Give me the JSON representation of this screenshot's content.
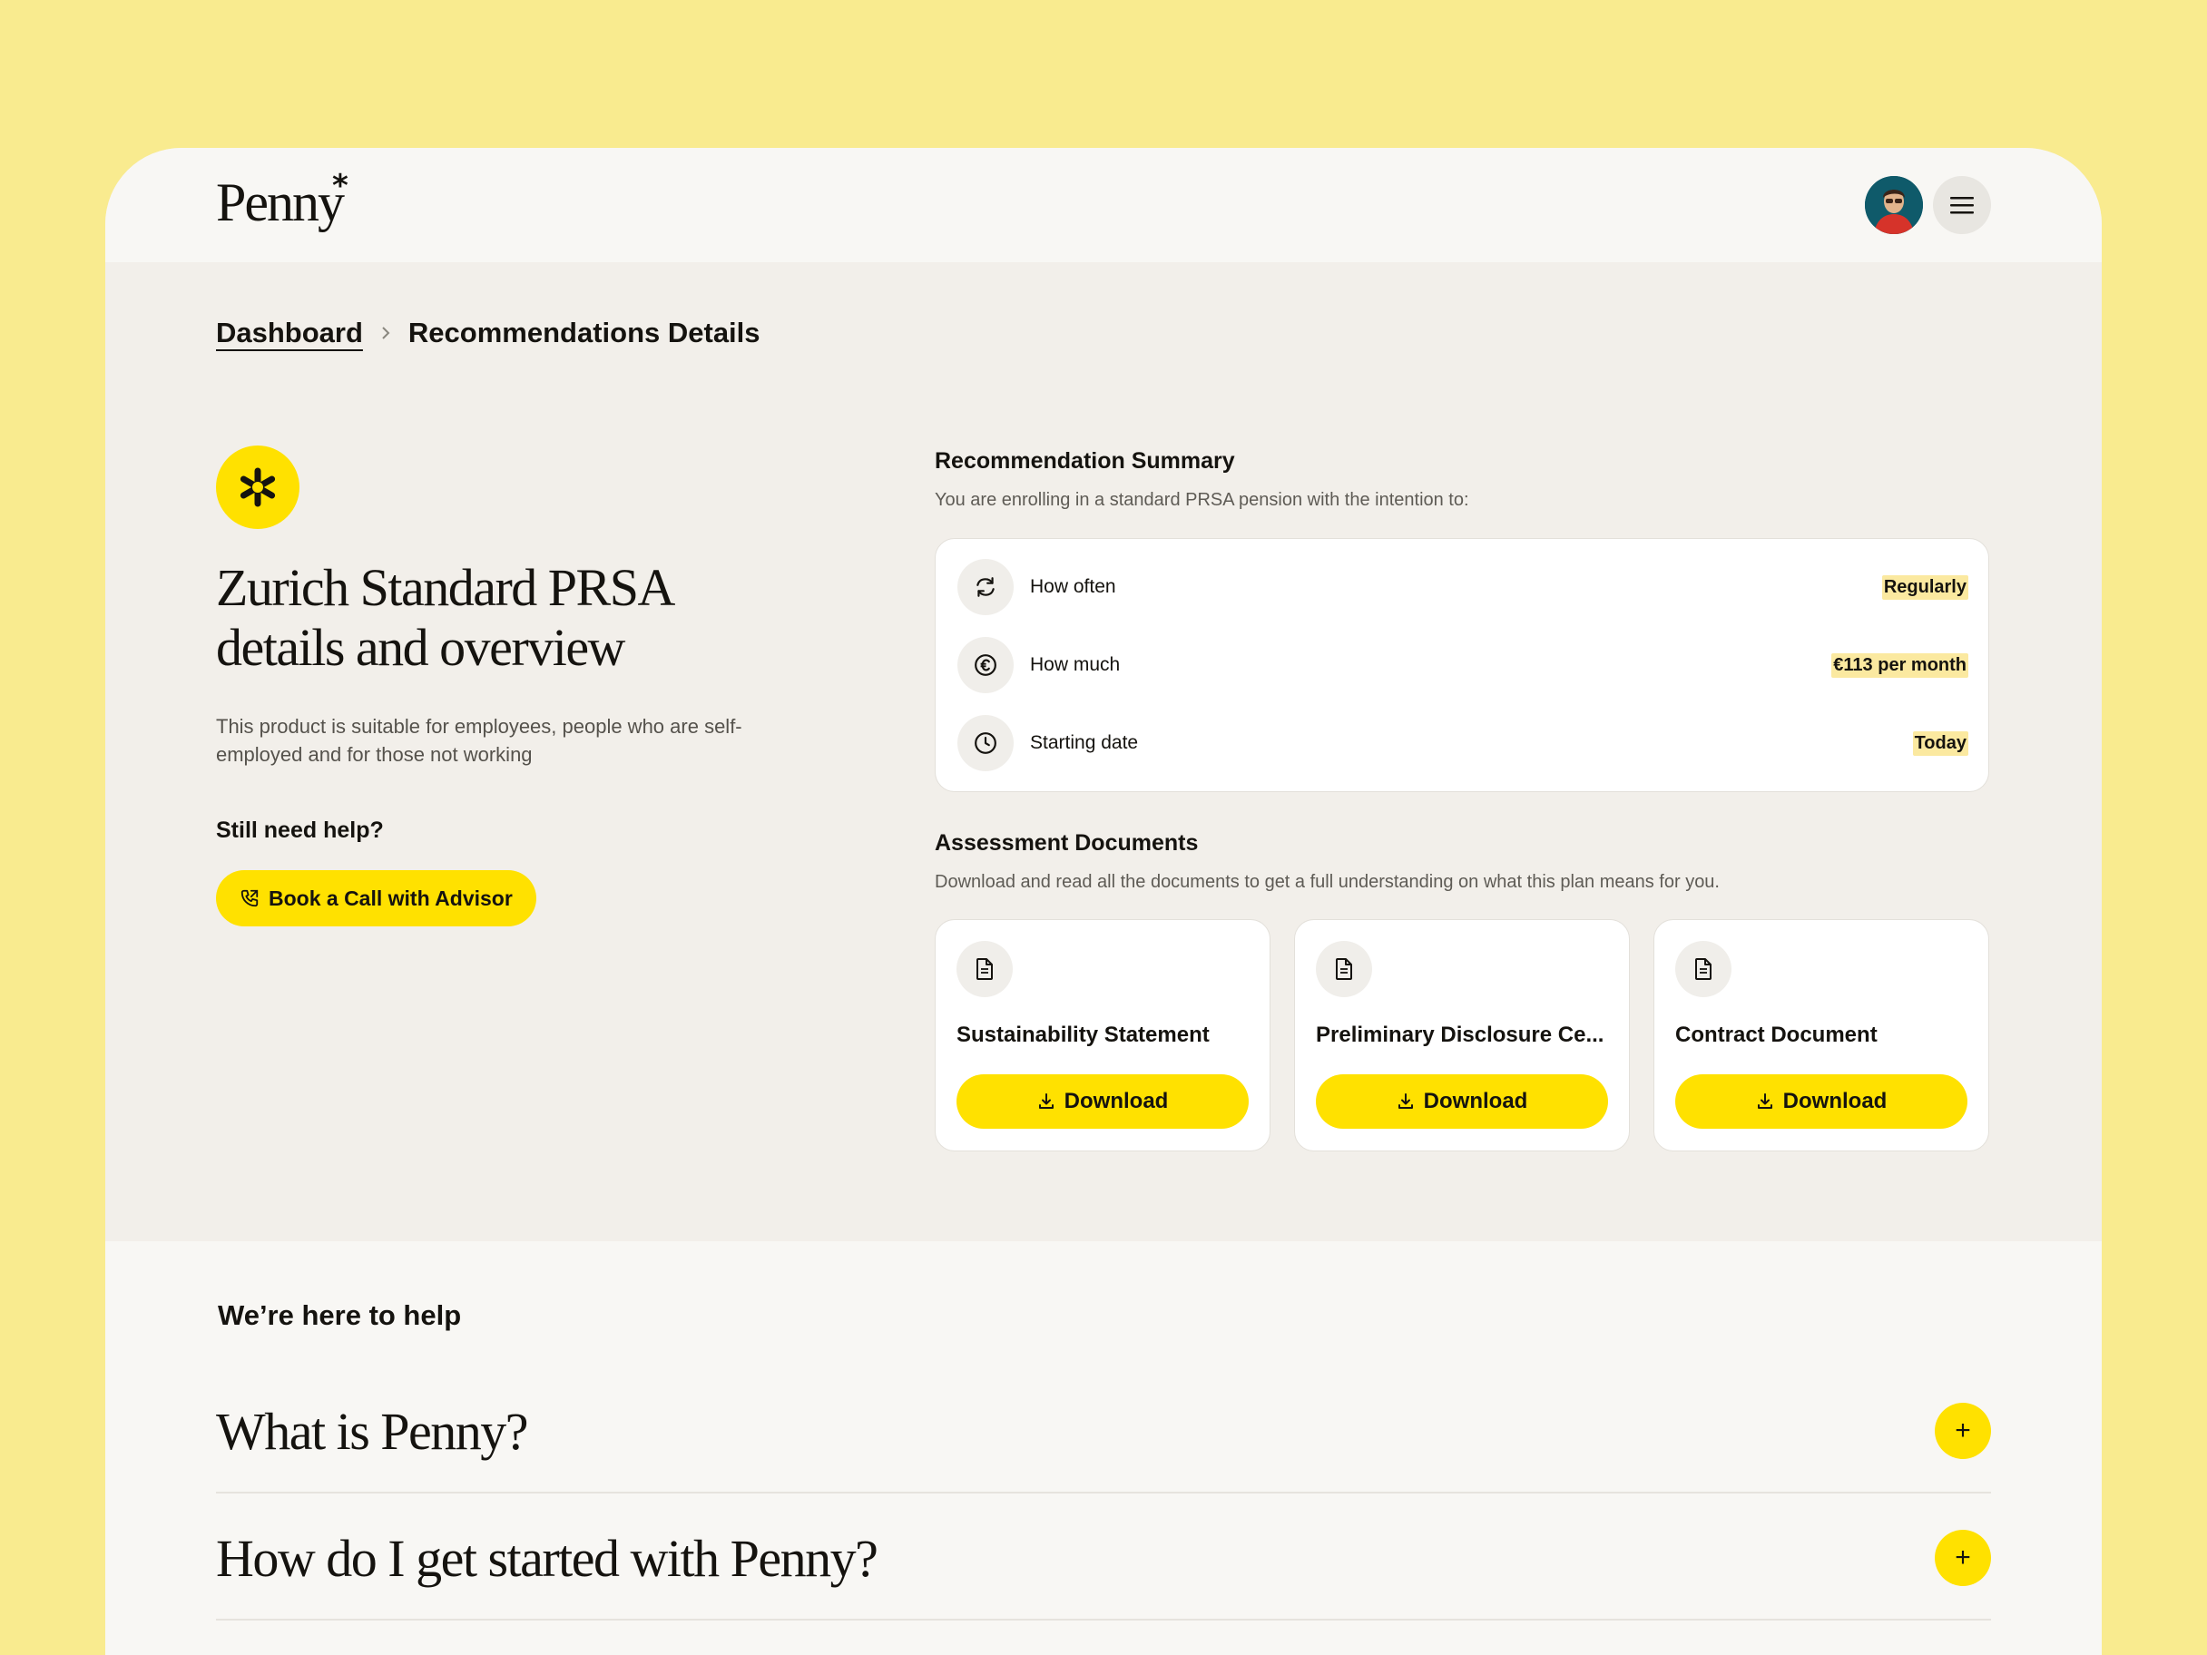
{
  "header": {
    "logo_text": "Penny",
    "logo_mark": "*",
    "avatar_icon": "user-avatar",
    "menu_icon": "hamburger-menu-icon"
  },
  "breadcrumb": {
    "parent": "Dashboard",
    "current": "Recommendations Details"
  },
  "product": {
    "badge_icon": "asterisk-icon",
    "title": "Zurich Standard PRSA details and overview",
    "description": "This product is suitable for employees, people who are self-employed and for those not working",
    "help_heading": "Still need help?",
    "call_button": "Book a Call with Advisor"
  },
  "summary": {
    "heading": "Recommendation Summary",
    "subtitle": "You are enrolling in a standard PRSA pension with the intention to:",
    "rows": [
      {
        "icon": "refresh-icon",
        "label": "How often",
        "value": "Regularly"
      },
      {
        "icon": "euro-icon",
        "label": "How much",
        "value": "€113 per month"
      },
      {
        "icon": "clock-icon",
        "label": "Starting date",
        "value": "Today"
      }
    ]
  },
  "documents": {
    "heading": "Assessment Documents",
    "subtitle": "Download and read all the documents to get a full understanding on what this plan means for you.",
    "download_label": "Download",
    "items": [
      {
        "title": "Sustainability Statement"
      },
      {
        "title": "Preliminary Disclosure Ce..."
      },
      {
        "title": "Contract Document"
      }
    ]
  },
  "help": {
    "title": "We’re here to help",
    "faqs": [
      {
        "question": "What is Penny?"
      },
      {
        "question": "How do I get started with Penny?"
      }
    ],
    "expand_symbol": "+"
  },
  "colors": {
    "background": "#f9eb8f",
    "accent": "#ffe100",
    "highlight": "#fbe9a0",
    "text": "#15130f"
  }
}
